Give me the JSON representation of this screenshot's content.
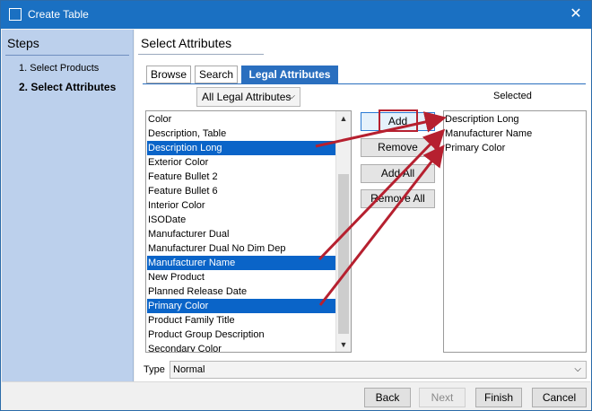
{
  "window": {
    "title": "Create Table",
    "close_glyph": "✕"
  },
  "steps": {
    "title": "Steps",
    "items": [
      {
        "label": "1. Select Products"
      },
      {
        "label": "2. Select Attributes"
      }
    ]
  },
  "main": {
    "section_title": "Select Attributes",
    "tabs": [
      {
        "label": "Browse"
      },
      {
        "label": "Search"
      },
      {
        "label": "Legal Attributes"
      }
    ],
    "filter": {
      "value": "All Legal Attributes",
      "chevron": "⌵"
    },
    "selected_label": "Selected",
    "available": [
      {
        "label": "Color"
      },
      {
        "label": "Description, Table"
      },
      {
        "label": "Description Long"
      },
      {
        "label": "Exterior Color"
      },
      {
        "label": "Feature Bullet 2"
      },
      {
        "label": "Feature Bullet 6"
      },
      {
        "label": "Interior Color"
      },
      {
        "label": "ISODate"
      },
      {
        "label": "Manufacturer Dual"
      },
      {
        "label": "Manufacturer Dual No Dim Dep"
      },
      {
        "label": "Manufacturer Name"
      },
      {
        "label": "New Product"
      },
      {
        "label": "Planned Release Date"
      },
      {
        "label": "Primary Color"
      },
      {
        "label": "Product Family Title"
      },
      {
        "label": "Product Group Description"
      },
      {
        "label": "Secondary Color"
      }
    ],
    "buttons": {
      "add": "Add",
      "remove": "Remove",
      "add_all": "Add All",
      "remove_all": "Remove All"
    },
    "selected": [
      {
        "label": "Description Long"
      },
      {
        "label": "Manufacturer Name"
      },
      {
        "label": "Primary Color"
      }
    ],
    "type": {
      "label": "Type",
      "value": "Normal",
      "chevron": "⌵"
    }
  },
  "footer": {
    "back": "Back",
    "next": "Next",
    "finish": "Finish",
    "cancel": "Cancel"
  },
  "colors": {
    "accent": "#1a70c2",
    "selection": "#0a64c8",
    "annotation": "#b6202f",
    "steps_panel": "#bcd0ec"
  },
  "icons": {
    "scroll_up": "▲",
    "scroll_down": "▼"
  }
}
